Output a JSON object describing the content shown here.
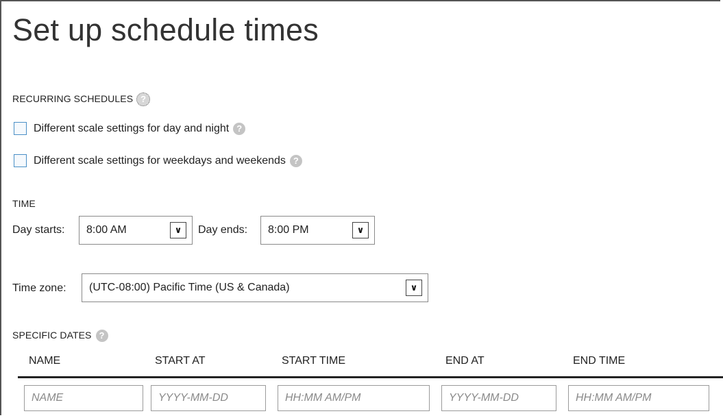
{
  "title": "Set up schedule times",
  "recurring": {
    "header": "RECURRING SCHEDULES",
    "options": [
      {
        "label": "Different scale settings for day and night",
        "checked": false
      },
      {
        "label": "Different scale settings for weekdays and weekends",
        "checked": false
      }
    ]
  },
  "time": {
    "header": "TIME",
    "day_starts_label": "Day starts:",
    "day_starts_value": "8:00 AM",
    "day_ends_label": "Day ends:",
    "day_ends_value": "8:00 PM",
    "timezone_label": "Time zone:",
    "timezone_value": "(UTC-08:00) Pacific Time (US & Canada)"
  },
  "specific_dates": {
    "header": "SPECIFIC DATES",
    "columns": [
      "NAME",
      "START AT",
      "START TIME",
      "END AT",
      "END TIME"
    ],
    "placeholders": [
      "NAME",
      "YYYY-MM-DD",
      "HH:MM AM/PM",
      "YYYY-MM-DD",
      "HH:MM AM/PM"
    ]
  },
  "icons": {
    "help": "question-circle-icon",
    "dropdown": "chevron-down-icon"
  },
  "colors": {
    "checkbox_border": "#4a8fc6",
    "help_icon": "#c4c4c4"
  }
}
